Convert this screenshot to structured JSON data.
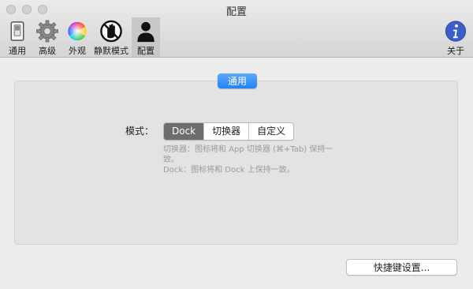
{
  "window": {
    "title": "配置"
  },
  "toolbar": {
    "items": [
      {
        "label": "通用",
        "icon": "switch-icon"
      },
      {
        "label": "高级",
        "icon": "gear-icon"
      },
      {
        "label": "外观",
        "icon": "color-wheel-icon"
      },
      {
        "label": "静默模式",
        "icon": "no-hand-icon"
      },
      {
        "label": "配置",
        "icon": "person-silhouette-icon",
        "selected": true
      }
    ],
    "about": {
      "label": "关于",
      "icon": "info-icon"
    }
  },
  "section_tab": {
    "label": "通用"
  },
  "mode": {
    "label": "模式：",
    "options": [
      "Dock",
      "切换器",
      "自定义"
    ],
    "selected": "Dock"
  },
  "descriptions": [
    "切换器：图标将和 App 切换器 (⌘+Tab) 保持一致。",
    "Dock：图标将和 Dock 上保持一致。"
  ],
  "shortcut_button": {
    "label": "快捷键设置..."
  },
  "colors": {
    "accent": "#2182f7",
    "selected_segment": "#6d6d6d"
  }
}
